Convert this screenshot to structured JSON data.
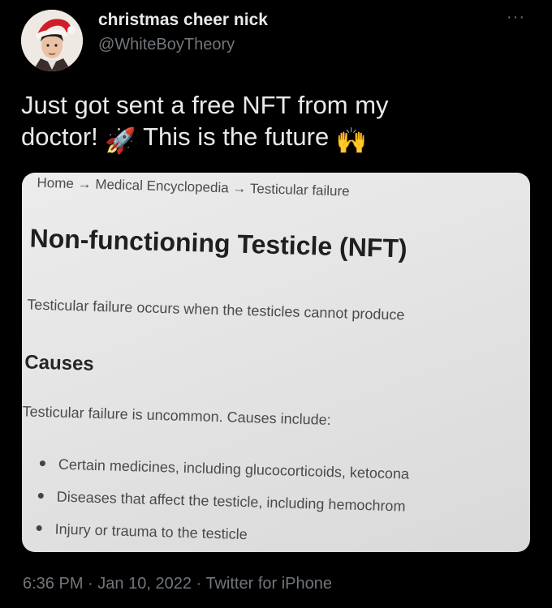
{
  "author": {
    "display_name": "christmas cheer nick",
    "handle": "@WhiteBoyTheory",
    "avatar_icon": "santa-hat-avatar-icon"
  },
  "more_label": "···",
  "tweet": {
    "line1": "Just got sent a free NFT from my",
    "line2_part1": "doctor!",
    "emoji1": "🚀",
    "line2_part2": "This is the future",
    "emoji2": "🙌"
  },
  "media": {
    "breadcrumb": {
      "home": "Home",
      "sep": "→",
      "encyclopedia": "Medical Encyclopedia",
      "current": "Testicular failure"
    },
    "title": "Non-functioning Testicle (NFT)",
    "intro": "Testicular failure occurs when the testicles cannot produce",
    "causes_heading": "Causes",
    "causes_text": "Testicular failure is uncommon. Causes include:",
    "bullets": [
      "Certain medicines, including glucocorticoids, ketocona",
      "Diseases that affect the testicle, including hemochrom",
      "Injury or trauma to the testicle"
    ]
  },
  "meta": {
    "time": "6:36 PM",
    "dot": "·",
    "date": "Jan 10, 2022",
    "source": "Twitter for iPhone"
  }
}
